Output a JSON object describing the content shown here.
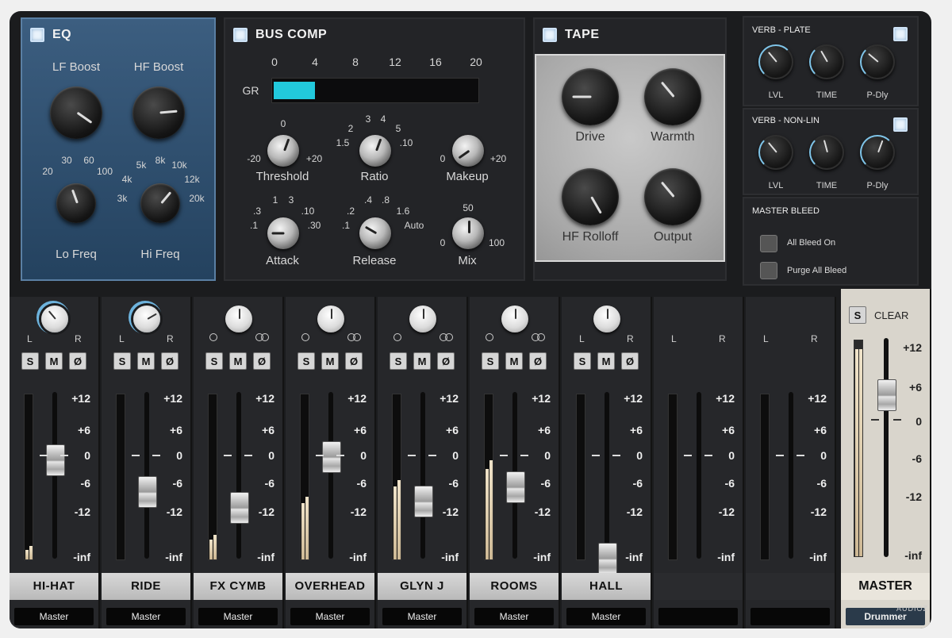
{
  "eq": {
    "title": "EQ",
    "lf_boost": "LF Boost",
    "hf_boost": "HF Boost",
    "lo_freq": "Lo Freq",
    "hi_freq": "Hi Freq",
    "lo_ticks": [
      "20",
      "30",
      "60",
      "100"
    ],
    "hi_ticks": [
      "3k",
      "4k",
      "5k",
      "8k",
      "10k",
      "12k",
      "20k"
    ]
  },
  "buscomp": {
    "title": "BUS COMP",
    "gr_label": "GR",
    "gr_scale": [
      "0",
      "4",
      "8",
      "12",
      "16",
      "20"
    ],
    "gr_level": 0.2,
    "threshold": "Threshold",
    "th_min": "-20",
    "th_mid": "0",
    "th_max": "+20",
    "ratio": "Ratio",
    "ratio_ticks": [
      "1.5",
      "2",
      "3",
      "4",
      "5",
      ".10"
    ],
    "makeup": "Makeup",
    "mk_min": "0",
    "mk_max": "+20",
    "attack": "Attack",
    "atk_ticks": [
      ".1",
      ".3",
      "1",
      "3",
      ".10",
      ".30"
    ],
    "release": "Release",
    "rel_ticks": [
      ".1",
      ".2",
      ".4",
      ".8",
      "1.6",
      "Auto"
    ],
    "mix": "Mix",
    "mix_min": "0",
    "mix_mid": "50",
    "mix_max": "100"
  },
  "tape": {
    "title": "TAPE",
    "drive": "Drive",
    "warmth": "Warmth",
    "hf_rolloff": "HF Rolloff",
    "output": "Output"
  },
  "verb_plate": {
    "title": "VERB - PLATE",
    "lvl": "LVL",
    "time": "TIME",
    "pdly": "P-Dly"
  },
  "verb_nonlin": {
    "title": "VERB - NON-LIN",
    "lvl": "LVL",
    "time": "TIME",
    "pdly": "P-Dly"
  },
  "master_bleed": {
    "title": "MASTER BLEED",
    "all_bleed": "All Bleed On",
    "purge": "Purge All Bleed"
  },
  "pan": {
    "l": "L",
    "r": "R"
  },
  "buttons": {
    "s": "S",
    "m": "M",
    "phase": "Ø"
  },
  "scale": [
    "+12",
    "+6",
    "0",
    "-6",
    "-12",
    "-inf"
  ],
  "channels": [
    {
      "name": "HI-HAT",
      "output": "Master",
      "stereo_pan": false
    },
    {
      "name": "RIDE",
      "output": "Master",
      "stereo_pan": false
    },
    {
      "name": "FX CYMB",
      "output": "Master",
      "stereo_pan": true
    },
    {
      "name": "OVERHEAD",
      "output": "Master",
      "stereo_pan": true
    },
    {
      "name": "GLYN J",
      "output": "Master",
      "stereo_pan": true
    },
    {
      "name": "ROOMS",
      "output": "Master",
      "stereo_pan": true
    },
    {
      "name": "HALL",
      "output": "Master",
      "stereo_pan": false
    },
    {
      "name": "",
      "output": "",
      "stereo_pan": false
    },
    {
      "name": "",
      "output": "",
      "stereo_pan": false
    }
  ],
  "master": {
    "name": "MASTER",
    "clear": "CLEAR",
    "s": "S",
    "output": "Drummer"
  },
  "watermark": "AUDIOZ",
  "colors": {
    "gr_meter": "#22c9dc",
    "eq_panel": "#2f4f6f"
  }
}
